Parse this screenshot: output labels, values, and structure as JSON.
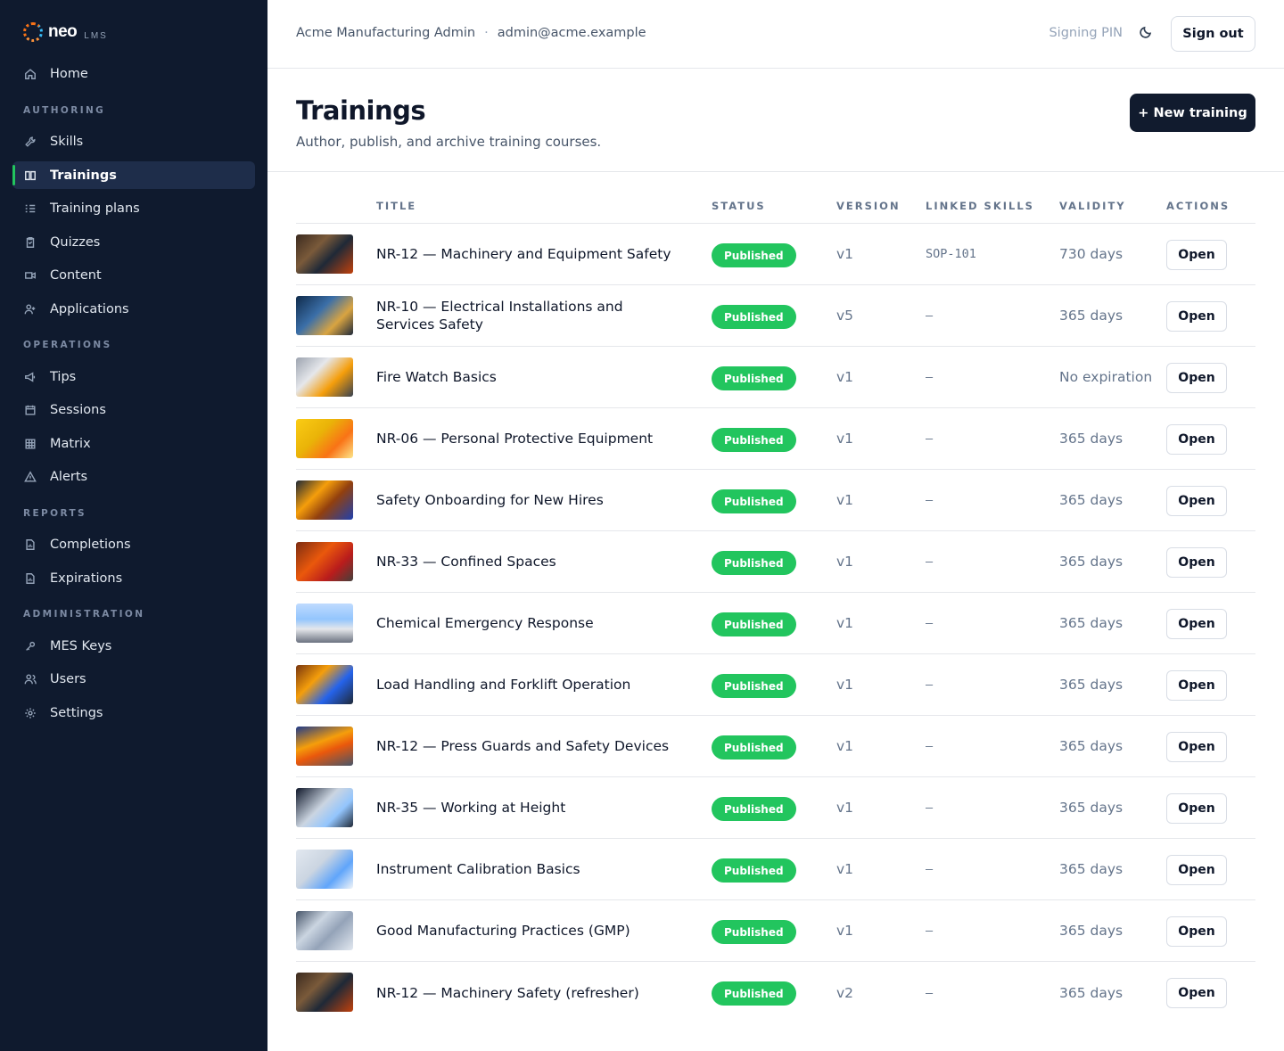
{
  "brand": {
    "name": "neo",
    "sub": "LMS"
  },
  "sidebar": {
    "home": "Home",
    "sections": {
      "authoring": "AUTHORING",
      "operations": "OPERATIONS",
      "reports": "REPORTS",
      "administration": "ADMINISTRATION"
    },
    "items": {
      "skills": "Skills",
      "trainings": "Trainings",
      "training_plans": "Training plans",
      "quizzes": "Quizzes",
      "content": "Content",
      "applications": "Applications",
      "tips": "Tips",
      "sessions": "Sessions",
      "matrix": "Matrix",
      "alerts": "Alerts",
      "completions": "Completions",
      "expirations": "Expirations",
      "mes_keys": "MES Keys",
      "users": "Users",
      "settings": "Settings"
    }
  },
  "topbar": {
    "org_name": "Acme Manufacturing Admin",
    "separator": "·",
    "email": "admin@acme.example",
    "signing_pin": "Signing PIN",
    "sign_out": "Sign out"
  },
  "header": {
    "title": "Trainings",
    "subtitle": "Author, publish, and archive training courses.",
    "new_button": "+ New training"
  },
  "table": {
    "columns": {
      "title": "TITLE",
      "status": "STATUS",
      "version": "VERSION",
      "linked_skills": "LINKED SKILLS",
      "validity": "VALIDITY",
      "actions": "ACTIONS"
    },
    "rows": [
      {
        "title": "NR-12 — Machinery and Equipment Safety",
        "status": "Published",
        "version": "v1",
        "skills": "SOP-101",
        "validity": "730 days",
        "action": "Open"
      },
      {
        "title": "NR-10 — Electrical Installations and Services Safety",
        "status": "Published",
        "version": "v5",
        "skills": "–",
        "validity": "365 days",
        "action": "Open"
      },
      {
        "title": "Fire Watch Basics",
        "status": "Published",
        "version": "v1",
        "skills": "–",
        "validity": "No expiration",
        "action": "Open"
      },
      {
        "title": "NR-06 — Personal Protective Equipment",
        "status": "Published",
        "version": "v1",
        "skills": "–",
        "validity": "365 days",
        "action": "Open"
      },
      {
        "title": "Safety Onboarding for New Hires",
        "status": "Published",
        "version": "v1",
        "skills": "–",
        "validity": "365 days",
        "action": "Open"
      },
      {
        "title": "NR-33 — Confined Spaces",
        "status": "Published",
        "version": "v1",
        "skills": "–",
        "validity": "365 days",
        "action": "Open"
      },
      {
        "title": "Chemical Emergency Response",
        "status": "Published",
        "version": "v1",
        "skills": "–",
        "validity": "365 days",
        "action": "Open"
      },
      {
        "title": "Load Handling and Forklift Operation",
        "status": "Published",
        "version": "v1",
        "skills": "–",
        "validity": "365 days",
        "action": "Open"
      },
      {
        "title": "NR-12 — Press Guards and Safety Devices",
        "status": "Published",
        "version": "v1",
        "skills": "–",
        "validity": "365 days",
        "action": "Open"
      },
      {
        "title": "NR-35 — Working at Height",
        "status": "Published",
        "version": "v1",
        "skills": "–",
        "validity": "365 days",
        "action": "Open"
      },
      {
        "title": "Instrument Calibration Basics",
        "status": "Published",
        "version": "v1",
        "skills": "–",
        "validity": "365 days",
        "action": "Open"
      },
      {
        "title": "Good Manufacturing Practices (GMP)",
        "status": "Published",
        "version": "v1",
        "skills": "–",
        "validity": "365 days",
        "action": "Open"
      },
      {
        "title": "NR-12 — Machinery Safety (refresher)",
        "status": "Published",
        "version": "v2",
        "skills": "–",
        "validity": "365 days",
        "action": "Open"
      }
    ]
  },
  "colors": {
    "sidebar_bg": "#0f1a2e",
    "active_bg": "#1e2d4a",
    "accent_green": "#22c55e",
    "primary_button": "#111b2e"
  }
}
